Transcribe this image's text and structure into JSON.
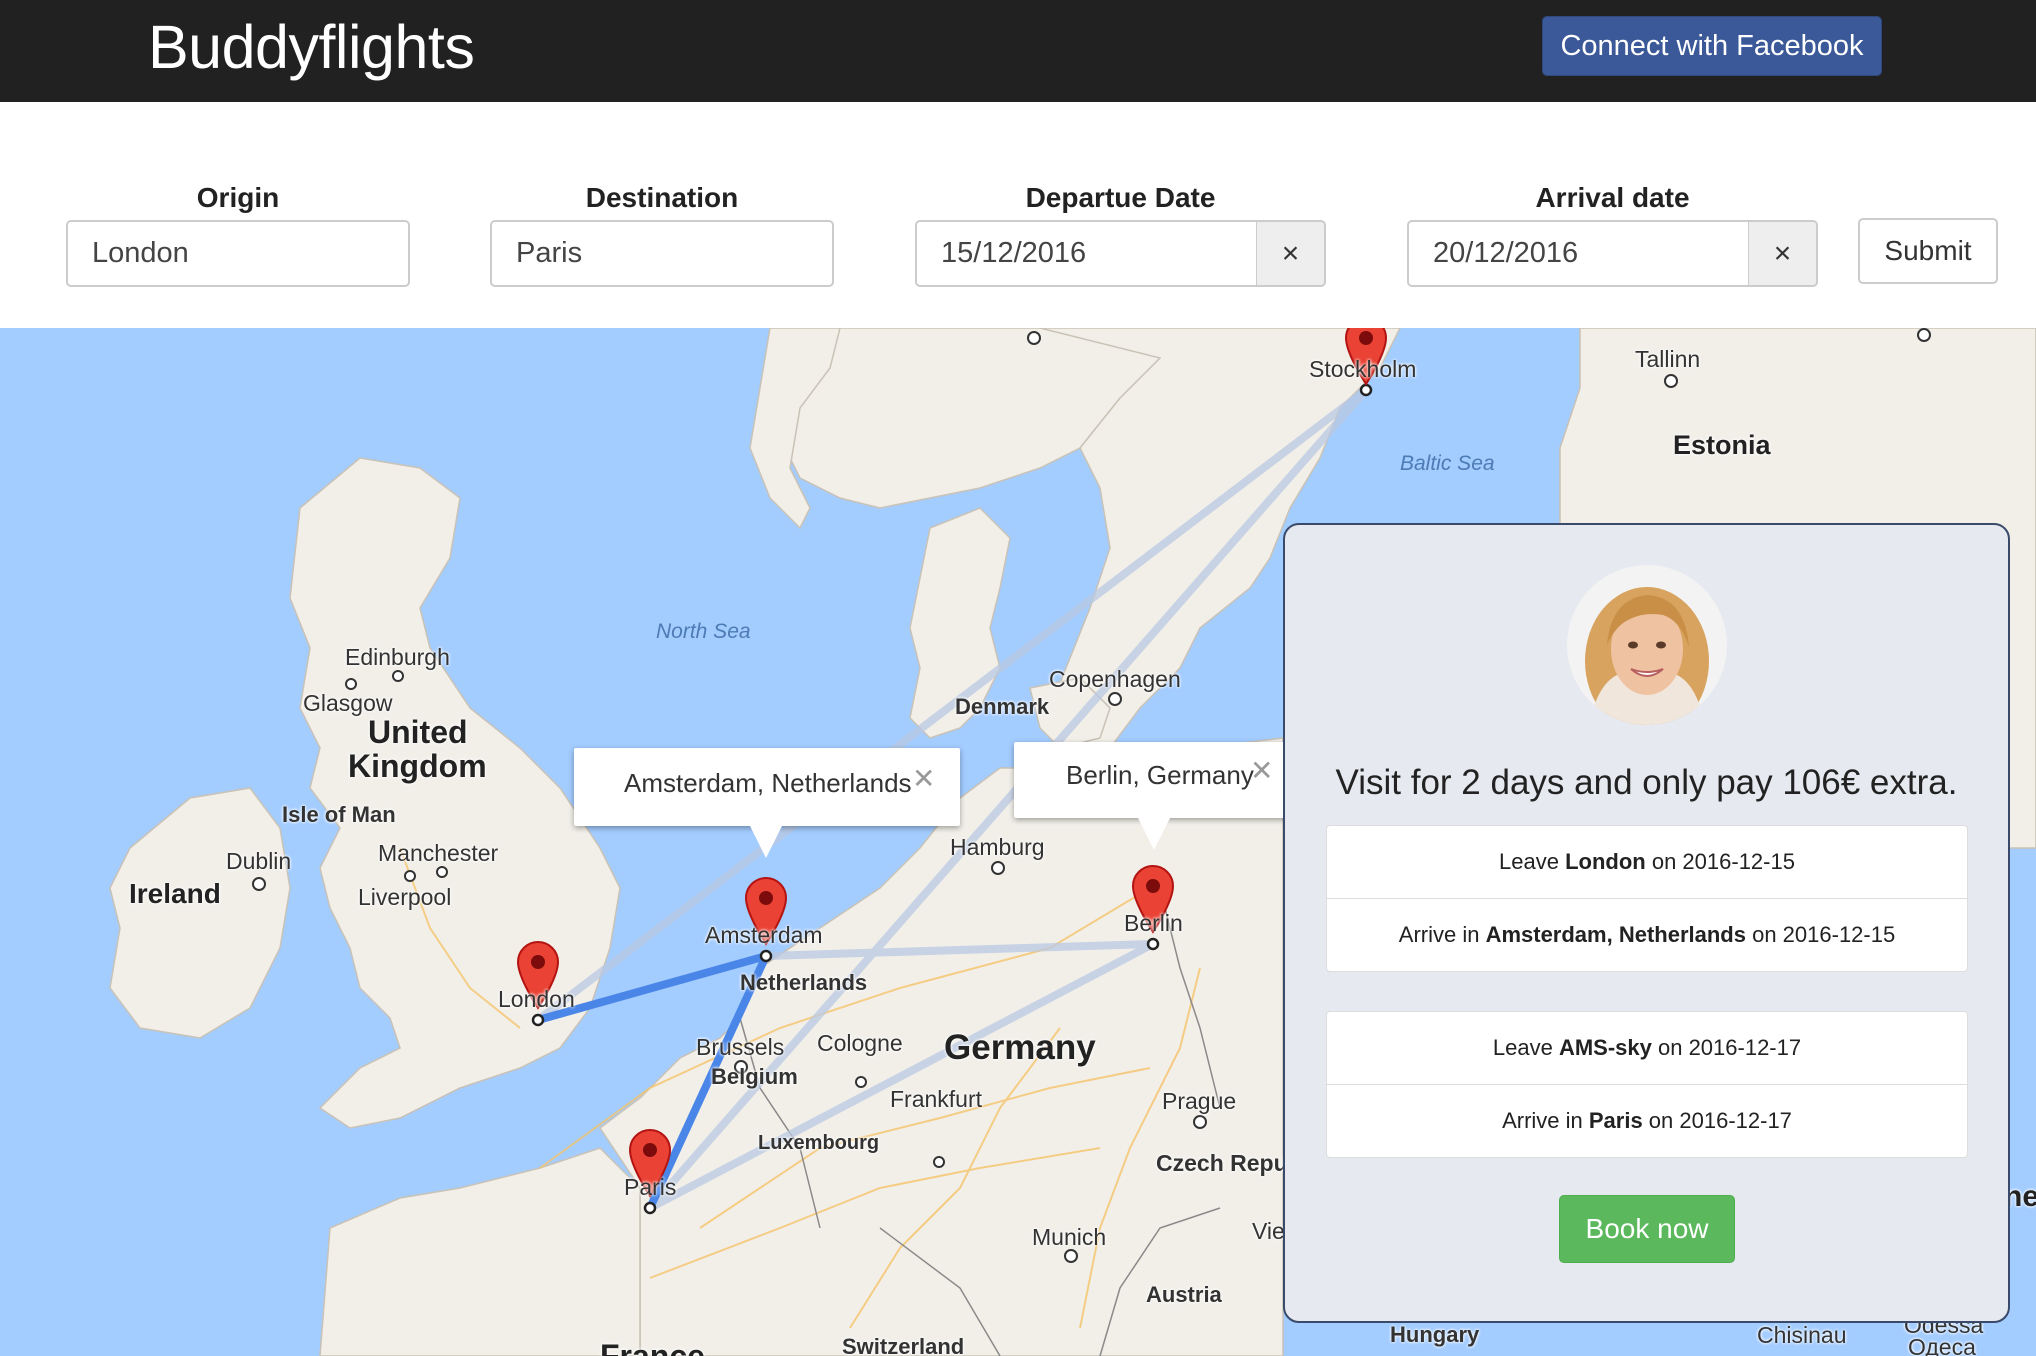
{
  "header": {
    "brand": "Buddyflights",
    "facebook_button": "Connect with Facebook"
  },
  "form": {
    "origin_label": "Origin",
    "origin_value": "London",
    "destination_label": "Destination",
    "destination_value": "Paris",
    "departure_label": "Departue Date",
    "departure_value": "15/12/2016",
    "arrival_label": "Arrival date",
    "arrival_value": "20/12/2016",
    "clear_glyph": "×",
    "submit_label": "Submit"
  },
  "map": {
    "cities": {
      "edinburgh": "Edinburgh",
      "glasgow": "Glasgow",
      "manchester": "Manchester",
      "liverpool": "Liverpool",
      "dublin": "Dublin",
      "london": "London",
      "amsterdam": "Amsterdam",
      "brussels": "Brussels",
      "cologne": "Cologne",
      "frankfurt": "Frankfurt",
      "paris": "Paris",
      "hamburg": "Hamburg",
      "berlin": "Berlin",
      "copenhagen": "Copenhagen",
      "stockholm": "Stockholm",
      "tallinn": "Tallinn",
      "prague": "Prague",
      "munich": "Munich",
      "vienna_partial": "Vie",
      "chisinau": "Chisinau",
      "odessa": "Odessa",
      "odessa_cyr": "Одеса"
    },
    "countries": {
      "uk_line1": "United",
      "uk_line2": "Kingdom",
      "ireland": "Ireland",
      "germany": "Germany",
      "estonia": "Estonia",
      "france_partial": "France",
      "czech_partial": "Czech Repu",
      "ukraine_partial": "ne"
    },
    "regions": {
      "isle_of_man": "Isle of Man",
      "denmark": "Denmark",
      "netherlands": "Netherlands",
      "belgium": "Belgium",
      "luxembourg": "Luxembourg",
      "austria": "Austria",
      "switzerland": "Switzerland",
      "hungary": "Hungary"
    },
    "seas": {
      "north_sea": "North Sea",
      "baltic_sea": "Baltic Sea"
    },
    "infowindows": {
      "amsterdam": "Amsterdam, Netherlands",
      "berlin": "Berlin, Germany",
      "close_glyph": "✕"
    },
    "colors": {
      "water": "#a3ccff",
      "land": "#f2efe9",
      "route_active": "#4a86e8",
      "route_faded": "#b9c9e3",
      "marker": "#ea4335"
    }
  },
  "panel": {
    "title": "Visit for 2 days and only pay 106€ extra.",
    "outbound": [
      {
        "prefix": "Leave ",
        "place": "London",
        "suffix": " on 2016-12-15"
      },
      {
        "prefix": "Arrive in ",
        "place": "Amsterdam, Netherlands",
        "suffix": " on 2016-12-15"
      }
    ],
    "return": [
      {
        "prefix": "Leave ",
        "place": "AMS-sky",
        "suffix": " on 2016-12-17"
      },
      {
        "prefix": "Arrive in ",
        "place": "Paris",
        "suffix": " on 2016-12-17"
      }
    ],
    "book_button": "Book now"
  }
}
